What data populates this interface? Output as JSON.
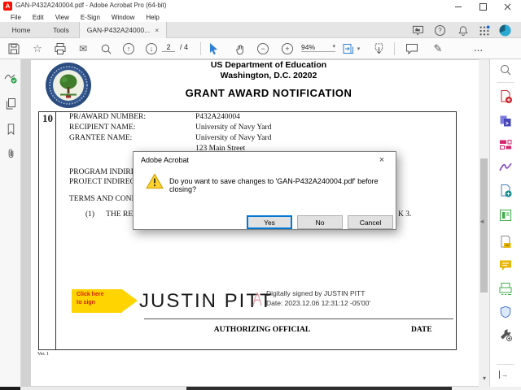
{
  "window": {
    "app_title": "GAN-P432A240004.pdf - Adobe Acrobat Pro (64-bit)"
  },
  "menu": {
    "items": [
      "File",
      "Edit",
      "View",
      "E-Sign",
      "Window",
      "Help"
    ]
  },
  "tabs": {
    "home_label": "Home",
    "tools_label": "Tools",
    "document_tab_label": "GAN-P432A24000...",
    "document_tab_close": "×"
  },
  "toolbar": {
    "page_number": "2",
    "page_total": "/ 4",
    "zoom_value": "94%",
    "more_label": "..."
  },
  "glyphs": {
    "star": "☆",
    "mail": "✉",
    "pencil": "✎",
    "up": "↑",
    "down": "↓",
    "caret": "▾",
    "minus": "−",
    "plus": "+",
    "question": "?",
    "collapse": "◄",
    "scroll_down": "▾",
    "expand": "→"
  },
  "left_panel": {
    "tools": [
      "signatures-panel",
      "page-thumbnails-panel",
      "bookmarks-panel",
      "attachments-panel"
    ]
  },
  "right_panel": {
    "tools": [
      "search-tool",
      "export-pdf",
      "combine-files",
      "edit-pdf",
      "fill-and-sign",
      "create-pdf",
      "organize-pages",
      "prepare-form",
      "comment",
      "scan-and-ocr",
      "protect",
      "more-tools",
      "expand-panel"
    ]
  },
  "document": {
    "org_line": "US Department of Education",
    "address_line": "Washington, D.C. 20202",
    "doc_title": "GRANT AWARD NOTIFICATION",
    "block_number": "10",
    "fields": [
      {
        "label": "PR/AWARD NUMBER:",
        "value": "P432A240004"
      },
      {
        "label": "RECIPIENT NAME:",
        "value": "University of Navy Yard"
      },
      {
        "label": "GRANTEE NAME:",
        "value": "University of Navy Yard"
      }
    ],
    "street_line": "123 Main Street",
    "clipped": {
      "program": "PROGRAM INDIRE",
      "project": "PROJECT INDIREC",
      "terms": "TERMS AND CONI",
      "item": "(1)      THE REC",
      "right_fragment": "K 3."
    },
    "signature": {
      "tag_line1": "Click here",
      "tag_line2": "to sign",
      "name": "JUSTIN PITT",
      "digital_line1": "Digitally signed by JUSTIN PITT",
      "digital_line2": "Date: 2023.12.06 12:31:12 -05'00'"
    },
    "footer": {
      "authorizing_label": "AUTHORIZING OFFICIAL",
      "date_label": "DATE",
      "version": "Ver. 1"
    }
  },
  "dialog": {
    "title": "Adobe Acrobat",
    "close_glyph": "×",
    "message": "Do you want to save changes to 'GAN-P432A240004.pdf' before closing?",
    "buttons": {
      "yes": "Yes",
      "no": "No",
      "cancel": "Cancel"
    }
  },
  "colors": {
    "acrobat_red": "#fa0f00",
    "accent_blue": "#0078d7",
    "warning_yellow": "#ffd335",
    "sign_tag_yellow": "#ffd400",
    "sign_tag_text": "#d21f00",
    "doc_background": "#d2d2d2"
  }
}
